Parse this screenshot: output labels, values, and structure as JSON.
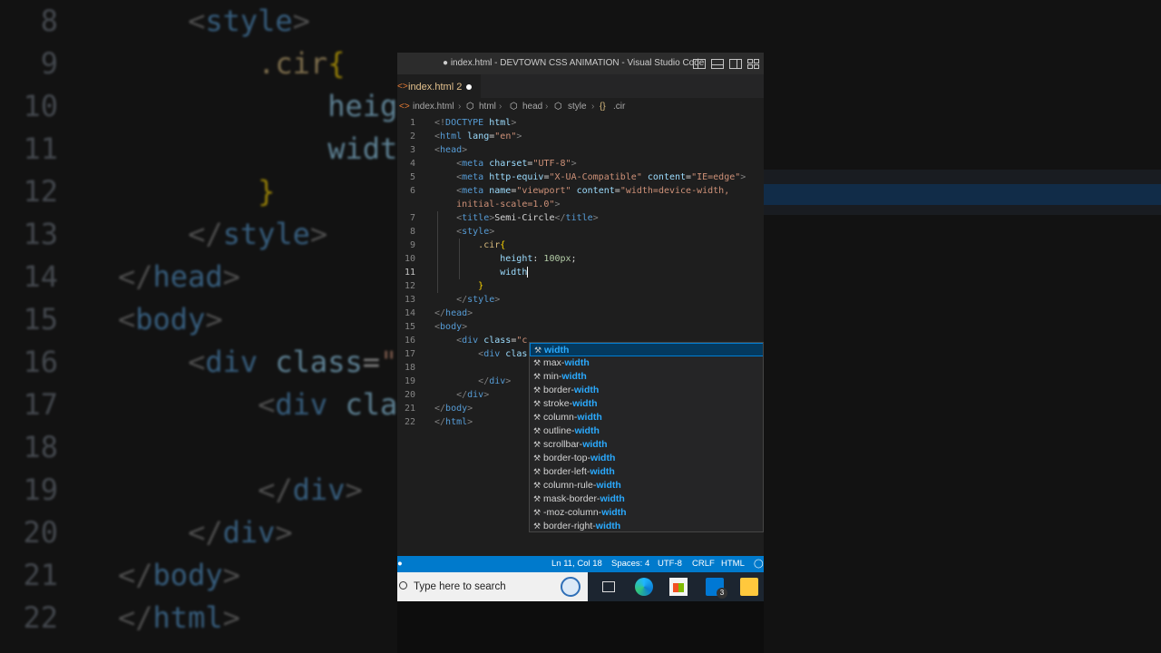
{
  "window": {
    "title": "● index.html - DEVTOWN CSS ANIMATION - Visual Studio Code"
  },
  "tab": {
    "icon": "<>",
    "label": "index.html 2"
  },
  "breadcrumb": [
    "index.html",
    "html",
    "head",
    "style",
    ".cir"
  ],
  "code_lines": [
    {
      "n": "1",
      "html": "<span class='t-br'>&lt;!</span><span class='t-tag'>DOCTYPE</span> <span class='t-attr'>html</span><span class='t-br'>&gt;</span>"
    },
    {
      "n": "2",
      "html": "<span class='t-br'>&lt;</span><span class='t-tag'>html</span> <span class='t-attr'>lang</span><span class='t-txt'>=</span><span class='t-str'>\"en\"</span><span class='t-br'>&gt;</span>"
    },
    {
      "n": "3",
      "html": "<span class='t-br'>&lt;</span><span class='t-tag'>head</span><span class='t-br'>&gt;</span>"
    },
    {
      "n": "4",
      "html": "    <span class='t-br'>&lt;</span><span class='t-tag'>meta</span> <span class='t-attr'>charset</span><span class='t-txt'>=</span><span class='t-str'>\"UTF-8\"</span><span class='t-br'>&gt;</span>"
    },
    {
      "n": "5",
      "html": "    <span class='t-br'>&lt;</span><span class='t-tag'>meta</span> <span class='t-attr'>http-equiv</span><span class='t-txt'>=</span><span class='t-str'>\"X-UA-Compatible\"</span> <span class='t-attr'>content</span><span class='t-txt'>=</span><span class='t-str'>\"IE=edge\"</span><span class='t-br'>&gt;</span>"
    },
    {
      "n": "6",
      "html": "    <span class='t-br'>&lt;</span><span class='t-tag'>meta</span> <span class='t-attr'>name</span><span class='t-txt'>=</span><span class='t-str'>\"viewport\"</span> <span class='t-attr'>content</span><span class='t-txt'>=</span><span class='t-str'>\"width=device-width,</span>"
    },
    {
      "n": "",
      "html": "    <span class='t-str'>initial-scale=1.0\"</span><span class='t-br'>&gt;</span>"
    },
    {
      "n": "7",
      "html": "    <span class='t-br'>&lt;</span><span class='t-tag'>title</span><span class='t-br'>&gt;</span><span class='t-txt'>Semi-Circle</span><span class='t-br'>&lt;/</span><span class='t-tag'>title</span><span class='t-br'>&gt;</span>"
    },
    {
      "n": "8",
      "html": "    <span class='t-br'>&lt;</span><span class='t-tag'>style</span><span class='t-br'>&gt;</span>"
    },
    {
      "n": "9",
      "html": "        <span class='t-sel'>.cir</span><span class='t-brace'>{</span>"
    },
    {
      "n": "10",
      "html": "            <span class='t-prop'>height</span><span class='t-txt'>: </span><span class='t-num'>100px</span><span class='t-txt'>;</span>"
    },
    {
      "n": "11",
      "html": "            <span class='t-prop'>width</span><span class='cursorbar'></span>",
      "active": true
    },
    {
      "n": "12",
      "html": "        <span class='t-brace'>}</span>"
    },
    {
      "n": "13",
      "html": "    <span class='t-br'>&lt;/</span><span class='t-tag'>style</span><span class='t-br'>&gt;</span>"
    },
    {
      "n": "14",
      "html": "<span class='t-br'>&lt;/</span><span class='t-tag'>head</span><span class='t-br'>&gt;</span>"
    },
    {
      "n": "15",
      "html": "<span class='t-br'>&lt;</span><span class='t-tag'>body</span><span class='t-br'>&gt;</span>"
    },
    {
      "n": "16",
      "html": "    <span class='t-br'>&lt;</span><span class='t-tag'>div</span> <span class='t-attr'>class</span><span class='t-txt'>=</span><span class='t-str'>\"c</span>"
    },
    {
      "n": "17",
      "html": "        <span class='t-br'>&lt;</span><span class='t-tag'>div</span> <span class='t-attr'>clas</span>"
    },
    {
      "n": "18",
      "html": ""
    },
    {
      "n": "19",
      "html": "        <span class='t-br'>&lt;/</span><span class='t-tag'>div</span><span class='t-br'>&gt;</span>"
    },
    {
      "n": "20",
      "html": "    <span class='t-br'>&lt;/</span><span class='t-tag'>div</span><span class='t-br'>&gt;</span>"
    },
    {
      "n": "21",
      "html": "<span class='t-br'>&lt;/</span><span class='t-tag'>body</span><span class='t-br'>&gt;</span>"
    },
    {
      "n": "22",
      "html": "<span class='t-br'>&lt;/</span><span class='t-tag'>html</span><span class='t-br'>&gt;</span>"
    }
  ],
  "suggestions": [
    {
      "pre": "",
      "match": "width",
      "icon": "wrench-icon"
    },
    {
      "pre": "max-",
      "match": "width",
      "icon": "wrench-icon"
    },
    {
      "pre": "min-",
      "match": "width",
      "icon": "wrench-icon"
    },
    {
      "pre": "border-",
      "match": "width",
      "icon": "wrench-icon"
    },
    {
      "pre": "stroke-",
      "match": "width",
      "icon": "wrench-icon"
    },
    {
      "pre": "column-",
      "match": "width",
      "icon": "wrench-icon"
    },
    {
      "pre": "outline-",
      "match": "width",
      "icon": "wrench-icon"
    },
    {
      "pre": "scrollbar-",
      "match": "width",
      "icon": "wrench-icon"
    },
    {
      "pre": "border-top-",
      "match": "width",
      "icon": "wrench-icon"
    },
    {
      "pre": "border-left-",
      "match": "width",
      "icon": "wrench-icon"
    },
    {
      "pre": "column-rule-",
      "match": "width",
      "icon": "wrench-icon"
    },
    {
      "pre": "mask-border-",
      "match": "width",
      "icon": "wrench-icon"
    },
    {
      "pre": "-moz-column-",
      "match": "width",
      "icon": "wrench-icon"
    },
    {
      "pre": "border-right-",
      "match": "width",
      "icon": "wrench-icon"
    }
  ],
  "status": {
    "position": "Ln 11, Col 18",
    "spaces": "Spaces: 4",
    "encoding": "UTF-8",
    "eol": "CRLF",
    "language": "HTML"
  },
  "taskbar": {
    "search_placeholder": "Type here to search",
    "mail_badge": "3"
  },
  "background_zoom": [
    {
      "n": "8",
      "html": "    <span class='t-br'>&lt;</span><span class='t-tag'>style</span><span class='t-br'>&gt;</span>"
    },
    {
      "n": "9",
      "html": "        <span class='t-sel'>.cir</span><span class='t-brace'>{</span>"
    },
    {
      "n": "10",
      "html": "            <span class='t-prop'>heig</span>"
    },
    {
      "n": "11",
      "html": "            <span class='t-prop'>widt</span>"
    },
    {
      "n": "12",
      "html": "        <span class='t-brace'>}</span>"
    },
    {
      "n": "13",
      "html": "    <span class='t-br'>&lt;/</span><span class='t-tag'>style</span><span class='t-br'>&gt;</span>"
    },
    {
      "n": "14",
      "html": "<span class='t-br'>&lt;/</span><span class='t-tag'>head</span><span class='t-br'>&gt;</span>"
    },
    {
      "n": "15",
      "html": "<span class='t-br'>&lt;</span><span class='t-tag'>body</span><span class='t-br'>&gt;</span>"
    },
    {
      "n": "16",
      "html": "    <span class='t-br'>&lt;</span><span class='t-tag'>div</span> <span class='t-attr'>class</span><span class='t-txt'>=</span><span class='t-str'>\"</span>"
    },
    {
      "n": "17",
      "html": "        <span class='t-br'>&lt;</span><span class='t-tag'>div</span> <span class='t-attr'>cla</span>"
    },
    {
      "n": "18",
      "html": ""
    },
    {
      "n": "19",
      "html": "        <span class='t-br'>&lt;/</span><span class='t-tag'>div</span><span class='t-br'>&gt;</span>"
    },
    {
      "n": "20",
      "html": "    <span class='t-br'>&lt;/</span><span class='t-tag'>div</span><span class='t-br'>&gt;</span>"
    },
    {
      "n": "21",
      "html": "<span class='t-br'>&lt;/</span><span class='t-tag'>body</span><span class='t-br'>&gt;</span>"
    },
    {
      "n": "22",
      "html": "<span class='t-br'>&lt;/</span><span class='t-tag'>html</span><span class='t-br'>&gt;</span>"
    }
  ]
}
